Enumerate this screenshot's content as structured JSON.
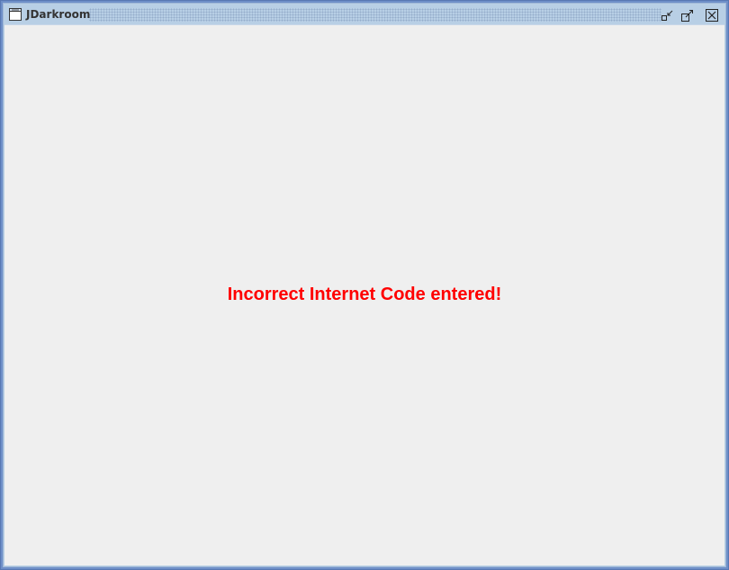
{
  "window": {
    "title": "JDarkroom",
    "buttons": {
      "minimize": "minimize-icon",
      "maximize": "maximize-icon",
      "close": "close-icon"
    }
  },
  "content": {
    "message": "Incorrect Internet Code entered!",
    "message_color": "#ff0000",
    "background_color": "#efefef"
  },
  "colors": {
    "window_frame": "#6e8fc8",
    "titlebar": "#b8cfe5"
  }
}
